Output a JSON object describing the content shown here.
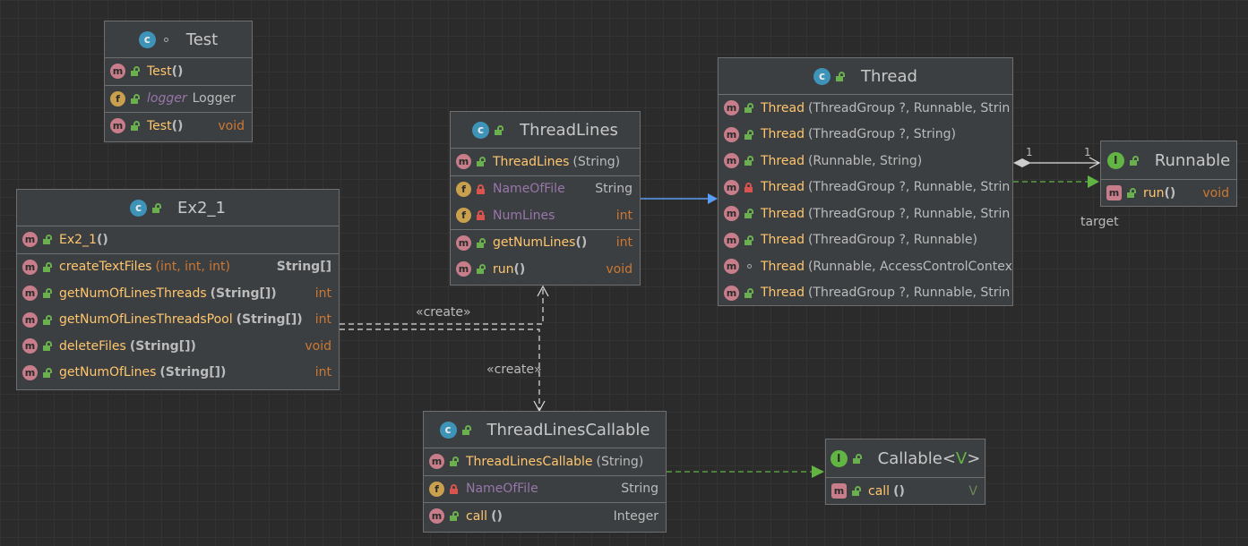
{
  "labels": {
    "create1": "«create»",
    "create2": "«create»",
    "target": "target",
    "mult_left": "1",
    "mult_right": "1"
  },
  "colors": {
    "accent_blue": "#589df6",
    "green": "#62b543",
    "method": "#ffc66d",
    "field": "#9876aa",
    "keyword": "#cc7832"
  },
  "classes": {
    "test": {
      "name": "Test",
      "icon": "class-icon",
      "rows": [
        {
          "kind": "m",
          "name": "Test",
          "params": "()",
          "type": ""
        },
        {
          "kind": "f",
          "name": "logger",
          "params": "",
          "type": "Logger"
        },
        {
          "kind": "m",
          "name": "Test",
          "params": "()",
          "type": "void"
        }
      ]
    },
    "ex2_1": {
      "name": "Ex2_1",
      "rows": [
        {
          "name": "Ex2_1",
          "params": "()",
          "type": ""
        },
        {
          "name": "createTextFiles",
          "params": "(int, int, int)",
          "type": "String[]"
        },
        {
          "name": "getNumOfLinesThreads",
          "params": "(String[])",
          "type": "int"
        },
        {
          "name": "getNumOfLinesThreadsPool",
          "params": "(String[])",
          "type": "int"
        },
        {
          "name": "deleteFiles",
          "params": "(String[])",
          "type": "void"
        },
        {
          "name": "getNumOfLines",
          "params": "(String[])",
          "type": "int"
        }
      ]
    },
    "threadlines": {
      "name": "ThreadLines",
      "rows": [
        {
          "name": "ThreadLines",
          "params": "(String)",
          "type": ""
        },
        {
          "name": "NameOfFile",
          "params": "",
          "type": "String"
        },
        {
          "name": "NumLines",
          "params": "",
          "type": "int"
        },
        {
          "name": "getNumLines",
          "params": "()",
          "type": "int"
        },
        {
          "name": "run",
          "params": "()",
          "type": "void"
        }
      ]
    },
    "thread": {
      "name": "Thread",
      "rows": [
        {
          "name": "Thread",
          "params": "(ThreadGroup ?, Runnable, Strin"
        },
        {
          "name": "Thread",
          "params": "(ThreadGroup ?, String)"
        },
        {
          "name": "Thread",
          "params": "(Runnable, String)"
        },
        {
          "name": "Thread",
          "params": "(ThreadGroup ?, Runnable, Strin"
        },
        {
          "name": "Thread",
          "params": "(ThreadGroup ?, Runnable, Strin"
        },
        {
          "name": "Thread",
          "params": "(ThreadGroup ?, Runnable)"
        },
        {
          "name": "Thread",
          "params": "(Runnable, AccessControlContex"
        },
        {
          "name": "Thread",
          "params": "(ThreadGroup ?, Runnable, Strin"
        }
      ]
    },
    "runnable": {
      "name": "Runnable",
      "rows": [
        {
          "name": "run",
          "params": "()",
          "type": "void"
        }
      ]
    },
    "threadlinescallable": {
      "name": "ThreadLinesCallable",
      "rows": [
        {
          "name": "ThreadLinesCallable",
          "params": "(String)",
          "type": ""
        },
        {
          "name": "NameOfFile",
          "params": "",
          "type": "String"
        },
        {
          "name": "call",
          "params": "()",
          "type": "Integer"
        }
      ]
    },
    "callable": {
      "name": "Callable",
      "generic": "V",
      "rows": [
        {
          "name": "call",
          "params": "()",
          "type": "V"
        }
      ]
    }
  }
}
